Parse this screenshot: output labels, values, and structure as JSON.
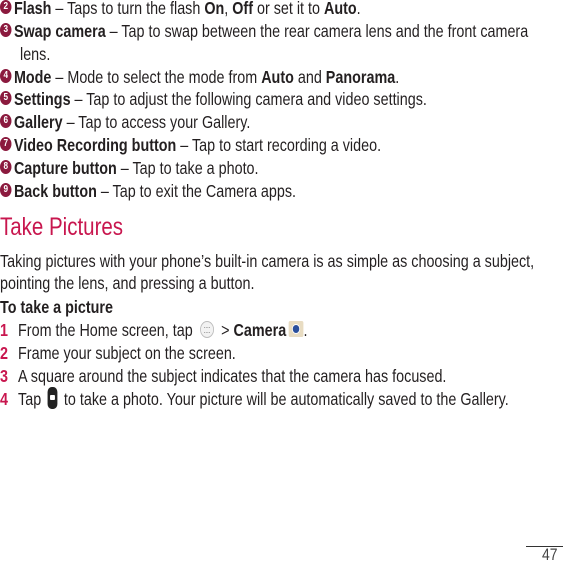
{
  "items": [
    {
      "badge": "2",
      "term": "Flash",
      "desc": " – Taps to turn the flash ",
      "b1": "On",
      "sep": ", ",
      "b2": "Off",
      "mid": " or set it to ",
      "b3": "Auto",
      "end": "."
    },
    {
      "badge": "3",
      "term": "Swap camera",
      "desc": " – Tap to swap between the rear camera lens and the front camera",
      "cont": "lens."
    },
    {
      "badge": "4",
      "term": "Mode",
      "desc": " – Mode to select the mode from ",
      "b1": "Auto",
      "mid": " and ",
      "b2": "Panorama",
      "end": "."
    },
    {
      "badge": "5",
      "term": "Settings",
      "desc": " – Tap to adjust the following camera and video settings."
    },
    {
      "badge": "6",
      "term": "Gallery",
      "desc": " – Tap to access your Gallery."
    },
    {
      "badge": "7",
      "term": "Video Recording button",
      "desc": " – Tap to start recording a video."
    },
    {
      "badge": "8",
      "term": "Capture button",
      "desc": " – Tap to take a photo."
    },
    {
      "badge": "9",
      "term": "Back button",
      "desc": " – Tap to exit the Camera apps."
    }
  ],
  "section": {
    "title": "Take Pictures",
    "intro_line1": "Taking pictures with your phone’s built-in camera is as simple as choosing a subject,",
    "intro_line2": "pointing the lens, and pressing a button.",
    "subheading": "To take a picture",
    "steps": [
      {
        "num": "1",
        "pre": "From the Home screen, tap ",
        "gt": " > ",
        "bold": "Camera",
        "icon1": "apps-icon",
        "icon2": "camera-app-icon",
        "end": "."
      },
      {
        "num": "2",
        "text": "Frame your subject on the screen."
      },
      {
        "num": "3",
        "text": "A square around the subject indicates that the camera has focused."
      },
      {
        "num": "4",
        "pre": "Tap ",
        "icon": "capture-button-icon",
        "post": " to take a photo. Your picture will be automatically saved to the Gallery."
      }
    ]
  },
  "footer": {
    "page_number": "47"
  },
  "colors": {
    "accent": "#c8164e",
    "badge": "#8b1a3e"
  }
}
